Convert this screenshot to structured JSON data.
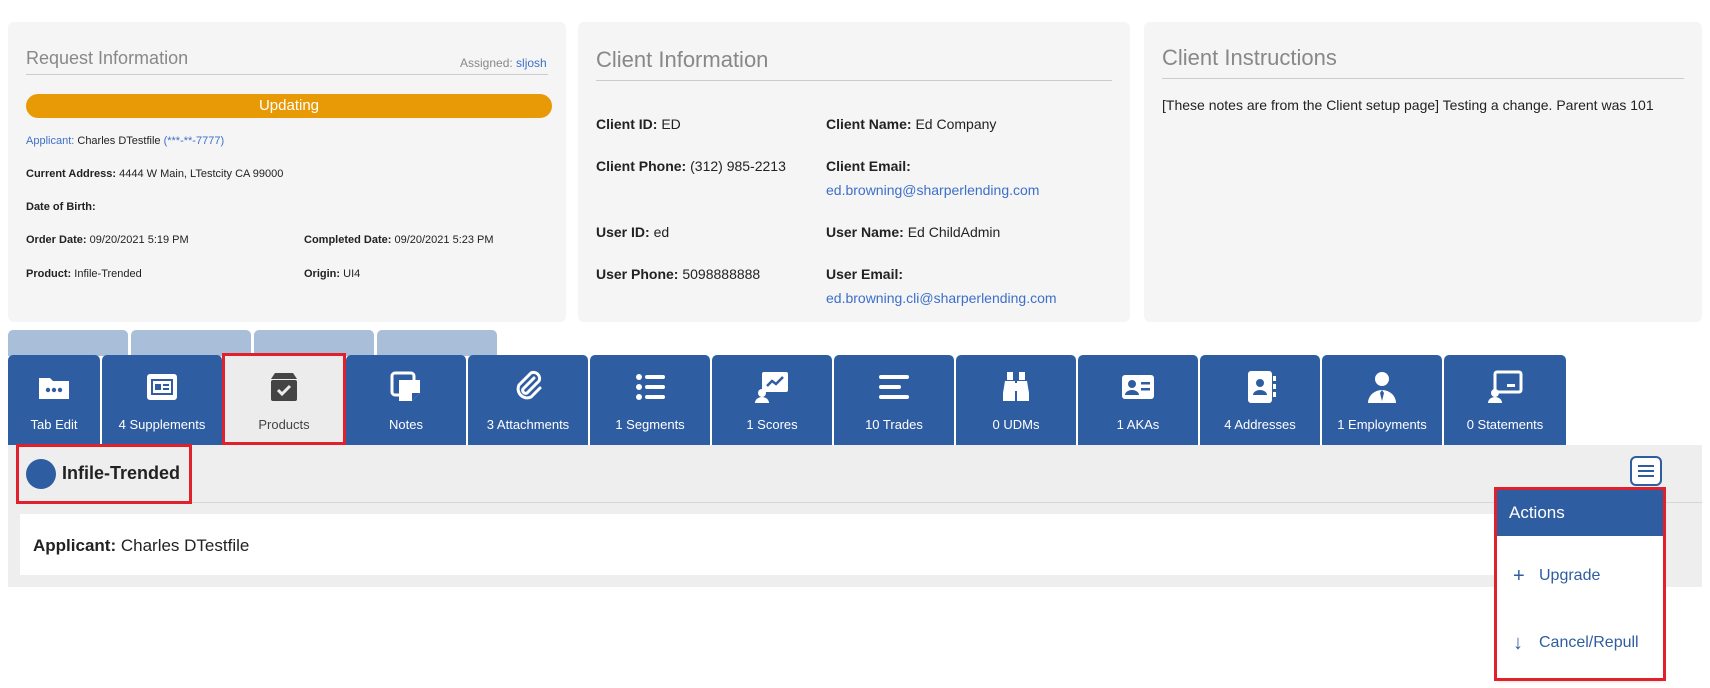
{
  "request_info": {
    "title": "Request Information",
    "assigned_label": "Assigned:",
    "assigned_user": "sljosh",
    "status": "Updating",
    "applicant_label": "Applicant:",
    "applicant_name": "Charles DTestfile",
    "applicant_ssn": "(***-**-7777)",
    "address_label": "Current Address:",
    "address_value": "4444 W Main, LTestcity CA 99000",
    "dob_label": "Date of Birth:",
    "order_date_label": "Order Date:",
    "order_date_value": "09/20/2021 5:19 PM",
    "completed_date_label": "Completed Date:",
    "completed_date_value": "09/20/2021 5:23 PM",
    "product_label": "Product:",
    "product_value": "Infile-Trended",
    "origin_label": "Origin:",
    "origin_value": "UI4"
  },
  "client_info": {
    "title": "Client Information",
    "client_id_label": "Client ID:",
    "client_id_value": "ED",
    "client_name_label": "Client Name:",
    "client_name_value": "Ed Company",
    "client_phone_label": "Client Phone:",
    "client_phone_value": "(312) 985-2213",
    "client_email_label": "Client Email:",
    "client_email_value": "ed.browning@sharperlending.com",
    "user_id_label": "User ID:",
    "user_id_value": "ed",
    "user_name_label": "User Name:",
    "user_name_value": "Ed ChildAdmin",
    "user_phone_label": "User Phone:",
    "user_phone_value": "5098888888",
    "user_email_label": "User Email:",
    "user_email_value": "ed.browning.cli@sharperlending.com"
  },
  "client_instructions": {
    "title": "Client Instructions",
    "text": "[These notes are from the Client setup page] Testing a change. Parent was 101"
  },
  "tabs": [
    {
      "label": "Tab Edit",
      "icon": "folder-dots-icon"
    },
    {
      "label": "4 Supplements",
      "icon": "id-card-icon"
    },
    {
      "label": "Products",
      "icon": "box-check-icon"
    },
    {
      "label": "Notes",
      "icon": "notes-icon"
    },
    {
      "label": "3 Attachments",
      "icon": "paperclip-icon"
    },
    {
      "label": "1 Segments",
      "icon": "list-icon"
    },
    {
      "label": "1 Scores",
      "icon": "chart-screen-icon"
    },
    {
      "label": "10 Trades",
      "icon": "lines-icon"
    },
    {
      "label": "0 UDMs",
      "icon": "binoculars-icon"
    },
    {
      "label": "1 AKAs",
      "icon": "contact-card-icon"
    },
    {
      "label": "4 Addresses",
      "icon": "address-book-icon"
    },
    {
      "label": "1 Employments",
      "icon": "user-tie-icon"
    },
    {
      "label": "0 Statements",
      "icon": "screen-user-icon"
    }
  ],
  "product_section": {
    "product_name": "Infile-Trended",
    "applicant_label": "Applicant:",
    "applicant_value": "Charles DTestfile"
  },
  "actions_menu": {
    "title": "Actions",
    "items": [
      {
        "label": "Upgrade",
        "icon": "plus-icon"
      },
      {
        "label": "Cancel/Repull",
        "icon": "arrow-down-icon"
      }
    ]
  },
  "colors": {
    "tab_blue": "#2f5da1",
    "status_orange": "#e89a06",
    "link_blue": "#3d6fc9",
    "highlight_red": "#e0202a"
  }
}
